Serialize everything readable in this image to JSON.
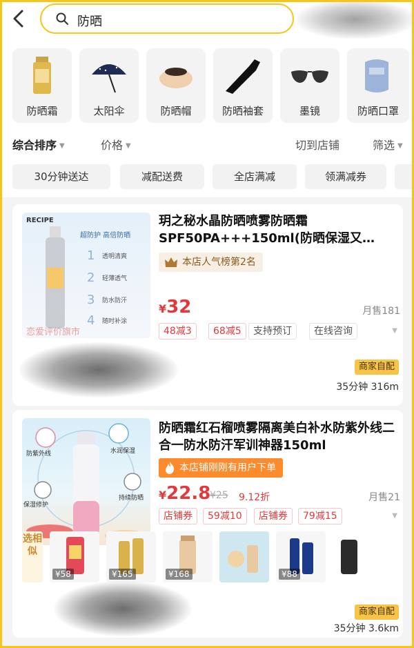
{
  "search": {
    "query": "防晒"
  },
  "categories": [
    {
      "label": "防晒霜"
    },
    {
      "label": "太阳伞"
    },
    {
      "label": "防晒帽"
    },
    {
      "label": "防晒袖套"
    },
    {
      "label": "墨镜"
    },
    {
      "label": "防晒口罩"
    }
  ],
  "sort": {
    "comprehensive": "综合排序",
    "price": "价格",
    "switch_store": "切到店铺",
    "filter": "筛选"
  },
  "chips": [
    "30分钟送达",
    "减配送费",
    "全店满减",
    "领满减券"
  ],
  "products": [
    {
      "title": "玥之秘水晶防晒喷雾防晒霜SPF50PA+++150ml(防晒保湿又…",
      "rank_badge": "本店人气榜第2名",
      "price_symbol": "¥",
      "price": "32",
      "monthly_sales": "月售181",
      "tags": [
        "48减3",
        "68减5",
        "支持预订",
        "在线咨询"
      ],
      "merchant_label": "商家自配",
      "eta": "35分钟  316m",
      "image_text": {
        "brand": "RECIPE",
        "headline": "超防护 高倍防晒",
        "points": [
          "1",
          "2",
          "3",
          "4"
        ],
        "feature_1": "透明清爽",
        "feature_2": "轻薄透气",
        "feature_3": "防水防汗",
        "feature_4": "随时补涂",
        "watermark": "恋爱评价旗市"
      }
    },
    {
      "title": "防晒霜红石榴喷雾隔离美白补水防紫外线二合一防水防汗军训神器150ml",
      "hot_badge": "本店铺刚刚有用户下单",
      "price_symbol": "¥",
      "price": "22.8",
      "original_price": "¥25",
      "discount": "9.12折",
      "monthly_sales": "月售21",
      "tags": [
        "店铺券",
        "59减10",
        "店铺券",
        "79减15"
      ],
      "similar_label": "选相似",
      "similar_prices": [
        "¥58",
        "¥165",
        "¥168",
        "¥88"
      ],
      "merchant_label": "商家自配",
      "eta": "35分钟  3.6km",
      "image_text": {
        "feature_1": "防紫外线",
        "feature_2": "水润保湿",
        "feature_3": "保湿修护",
        "feature_4": "持续防晒"
      }
    }
  ],
  "colors": {
    "accent_yellow": "#f5c518",
    "price_red": "#e4393c",
    "hot_orange": "#ff8a2b",
    "merchant_badge": "#f7c448"
  }
}
